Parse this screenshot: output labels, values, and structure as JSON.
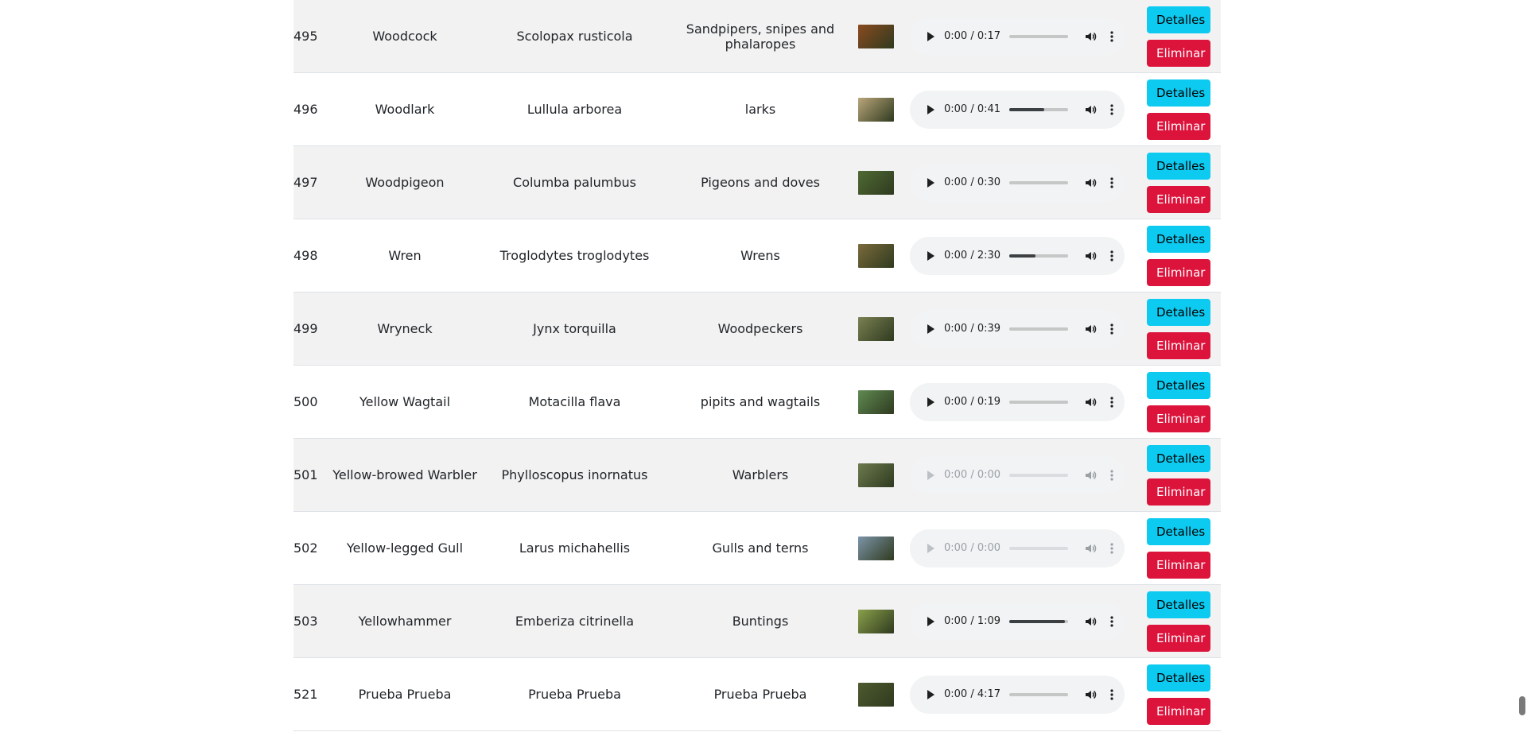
{
  "rows": [
    {
      "id": "495",
      "name": "Woodcock",
      "scientific": "Scolopax rusticola",
      "family": "Sandpipers, snipes and phalaropes",
      "time": "0:00 / 0:17",
      "progress": 0,
      "disabled": false,
      "img_color": "#8a4a1f"
    },
    {
      "id": "496",
      "name": "Woodlark",
      "scientific": "Lullula arborea",
      "family": "larks",
      "time": "0:00 / 0:41",
      "progress": 0.6,
      "disabled": false,
      "img_color": "#b9a57a"
    },
    {
      "id": "497",
      "name": "Woodpigeon",
      "scientific": "Columba palumbus",
      "family": "Pigeons and doves",
      "time": "0:00 / 0:30",
      "progress": 0,
      "disabled": false,
      "img_color": "#4f6a33"
    },
    {
      "id": "498",
      "name": "Wren",
      "scientific": "Troglodytes troglodytes",
      "family": "Wrens",
      "time": "0:00 / 2:30",
      "progress": 0.45,
      "disabled": false,
      "img_color": "#7a6a3b"
    },
    {
      "id": "499",
      "name": "Wryneck",
      "scientific": "Jynx torquilla",
      "family": "Woodpeckers",
      "time": "0:00 / 0:39",
      "progress": 0,
      "disabled": false,
      "img_color": "#7a8052"
    },
    {
      "id": "500",
      "name": "Yellow Wagtail",
      "scientific": "Motacilla flava",
      "family": "pipits and wagtails",
      "time": "0:00 / 0:19",
      "progress": 0,
      "disabled": false,
      "img_color": "#5f8a52"
    },
    {
      "id": "501",
      "name": "Yellow-browed Warbler",
      "scientific": "Phylloscopus inornatus",
      "family": "Warblers",
      "time": "0:00 / 0:00",
      "progress": 0,
      "disabled": true,
      "img_color": "#6c7a4e"
    },
    {
      "id": "502",
      "name": "Yellow-legged Gull",
      "scientific": "Larus michahellis",
      "family": "Gulls and terns",
      "time": "0:00 / 0:00",
      "progress": 0,
      "disabled": true,
      "img_color": "#7c94a8"
    },
    {
      "id": "503",
      "name": "Yellowhammer",
      "scientific": "Emberiza citrinella",
      "family": "Buntings",
      "time": "0:00 / 1:09",
      "progress": 0.95,
      "disabled": false,
      "img_color": "#8aa04a"
    },
    {
      "id": "521",
      "name": "Prueba Prueba",
      "scientific": "Prueba Prueba",
      "family": "Prueba Prueba",
      "time": "0:00 / 4:17",
      "progress": 0,
      "disabled": false,
      "img_color": "#4e5a2e"
    }
  ],
  "labels": {
    "details": "Detalles",
    "delete": "Eliminar"
  },
  "colors": {
    "details_btn": "#0dcaf0",
    "delete_btn": "#dc143c",
    "stripe": "#f2f2f2"
  }
}
